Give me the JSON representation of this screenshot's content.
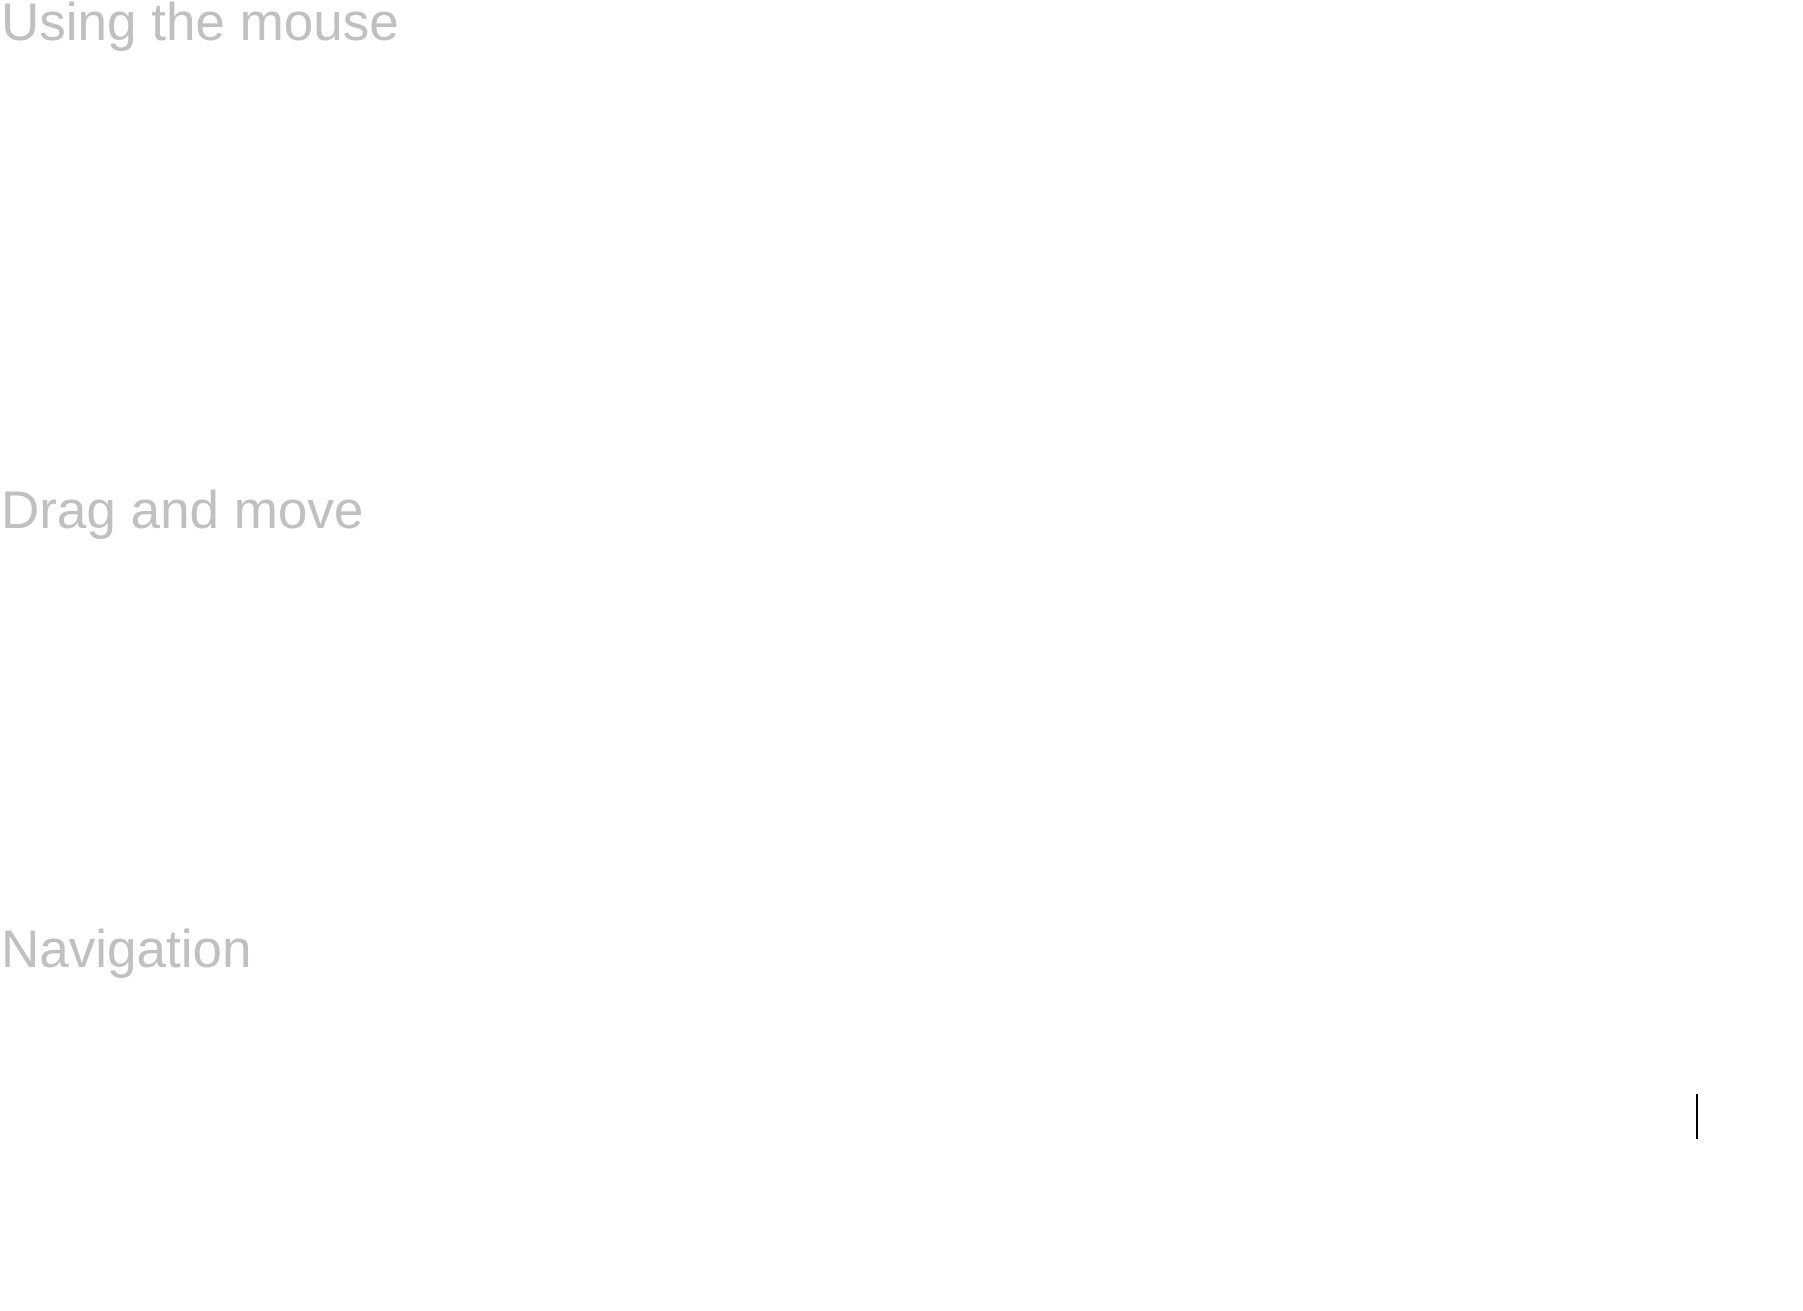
{
  "sections": [
    {
      "heading": "Using the mouse"
    },
    {
      "heading": "Drag and move"
    },
    {
      "heading": "Navigation"
    }
  ],
  "colors": {
    "heading_text": "#c0c0c0",
    "background": "#ffffff",
    "cursor": "#000000"
  },
  "cursor": {
    "icon": "text-cursor-icon"
  }
}
